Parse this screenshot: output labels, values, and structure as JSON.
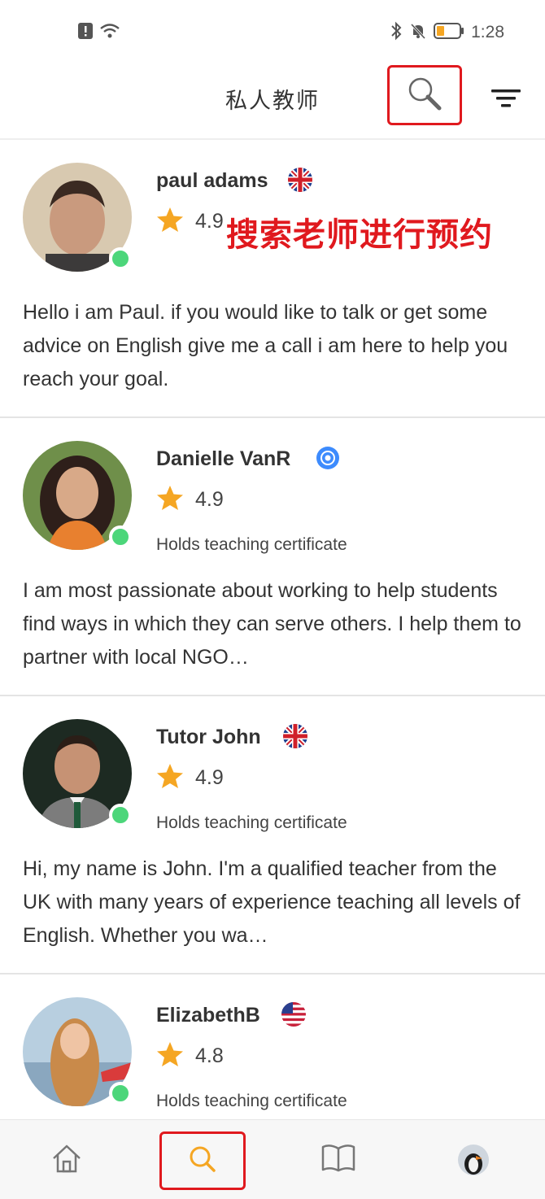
{
  "status_bar": {
    "time": "1:28"
  },
  "header": {
    "title": "私人教师"
  },
  "annotation": "搜索老师进行预约",
  "tutors": [
    {
      "name": "paul adams",
      "badge": "uk-flag-icon",
      "rating": "4.9",
      "certificate": "",
      "bio": "Hello i am Paul. if you would like to talk or get some advice on English give me a call i am here to help you reach your goal."
    },
    {
      "name": "Danielle VanR",
      "badge": "verified-badge-icon",
      "rating": "4.9",
      "certificate": "Holds teaching certificate",
      "bio": "I am most passionate about working to help students find ways in which they can serve others. I help them to partner with local NGO…"
    },
    {
      "name": "Tutor John",
      "badge": "uk-flag-icon",
      "rating": "4.9",
      "certificate": "Holds teaching certificate",
      "bio": "Hi, my name is John. I'm a qualified teacher from the UK with many years of experience teaching all levels of English. Whether you wa…"
    },
    {
      "name": "ElizabethB",
      "badge": "us-flag-icon",
      "rating": "4.8",
      "certificate": "Holds teaching certificate",
      "bio": ""
    }
  ],
  "tab_bar": {
    "tabs": [
      {
        "icon": "home-icon"
      },
      {
        "icon": "search-icon",
        "active": true
      },
      {
        "icon": "book-icon"
      },
      {
        "icon": "profile-avatar"
      }
    ]
  },
  "colors": {
    "accent": "#f5a623",
    "online": "#4cd67a",
    "highlight": "#e0191e",
    "verified": "#3d8bfd"
  }
}
